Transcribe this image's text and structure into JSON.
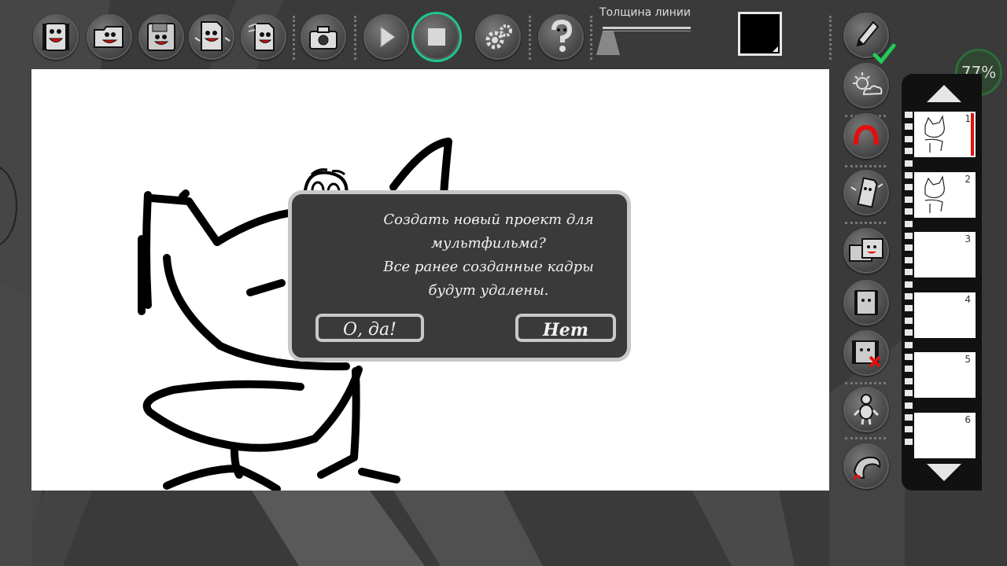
{
  "toolbar": {
    "items": [
      {
        "name": "new-project",
        "icon": "film-face-icon"
      },
      {
        "name": "open",
        "icon": "folder-face-icon"
      },
      {
        "name": "save",
        "icon": "floppy-face-icon"
      },
      {
        "name": "save-as",
        "icon": "page-face-icon"
      },
      {
        "name": "export",
        "icon": "page-face-lines-icon"
      },
      {
        "name": "snapshot",
        "icon": "camera-icon"
      },
      {
        "name": "play",
        "icon": "play-icon"
      },
      {
        "name": "stop",
        "icon": "stop-icon"
      },
      {
        "name": "settings",
        "icon": "gears-icon"
      },
      {
        "name": "help",
        "icon": "question-mascot-icon"
      }
    ],
    "line_thickness_label": "Толщина линии",
    "line_thickness_value": 0.1,
    "current_color": "#000000"
  },
  "zoom": {
    "label": "77%"
  },
  "right_tools": [
    {
      "name": "pencil",
      "icon": "pencil-icon",
      "selected": true
    },
    {
      "name": "background",
      "icon": "sun-cloud-icon"
    },
    {
      "name": "undo",
      "icon": "undo-arc-icon"
    },
    {
      "name": "add-frame",
      "icon": "page-face-icon"
    },
    {
      "name": "copy-frame",
      "icon": "film-double-icon"
    },
    {
      "name": "insert-frame",
      "icon": "film-icon"
    },
    {
      "name": "delete-frame",
      "icon": "film-delete-icon"
    },
    {
      "name": "character",
      "icon": "figure-icon"
    },
    {
      "name": "dolphin",
      "icon": "dolphin-icon"
    }
  ],
  "filmstrip": {
    "frames": [
      {
        "number": "1",
        "active": true
      },
      {
        "number": "2",
        "active": false
      },
      {
        "number": "3",
        "active": false
      },
      {
        "number": "4",
        "active": false
      },
      {
        "number": "5",
        "active": false
      },
      {
        "number": "6",
        "active": false
      }
    ]
  },
  "dialog": {
    "message_line1": "Создать новый проект для",
    "message_line2": "мультфильма?",
    "message_line3": "Все ранее созданные кадры",
    "message_line4": "будут удалены.",
    "yes_label": "О, да!",
    "no_label": "Нет"
  },
  "colors": {
    "accent": "#1ec98c",
    "delete": "#e01010",
    "check": "#22cc55"
  }
}
